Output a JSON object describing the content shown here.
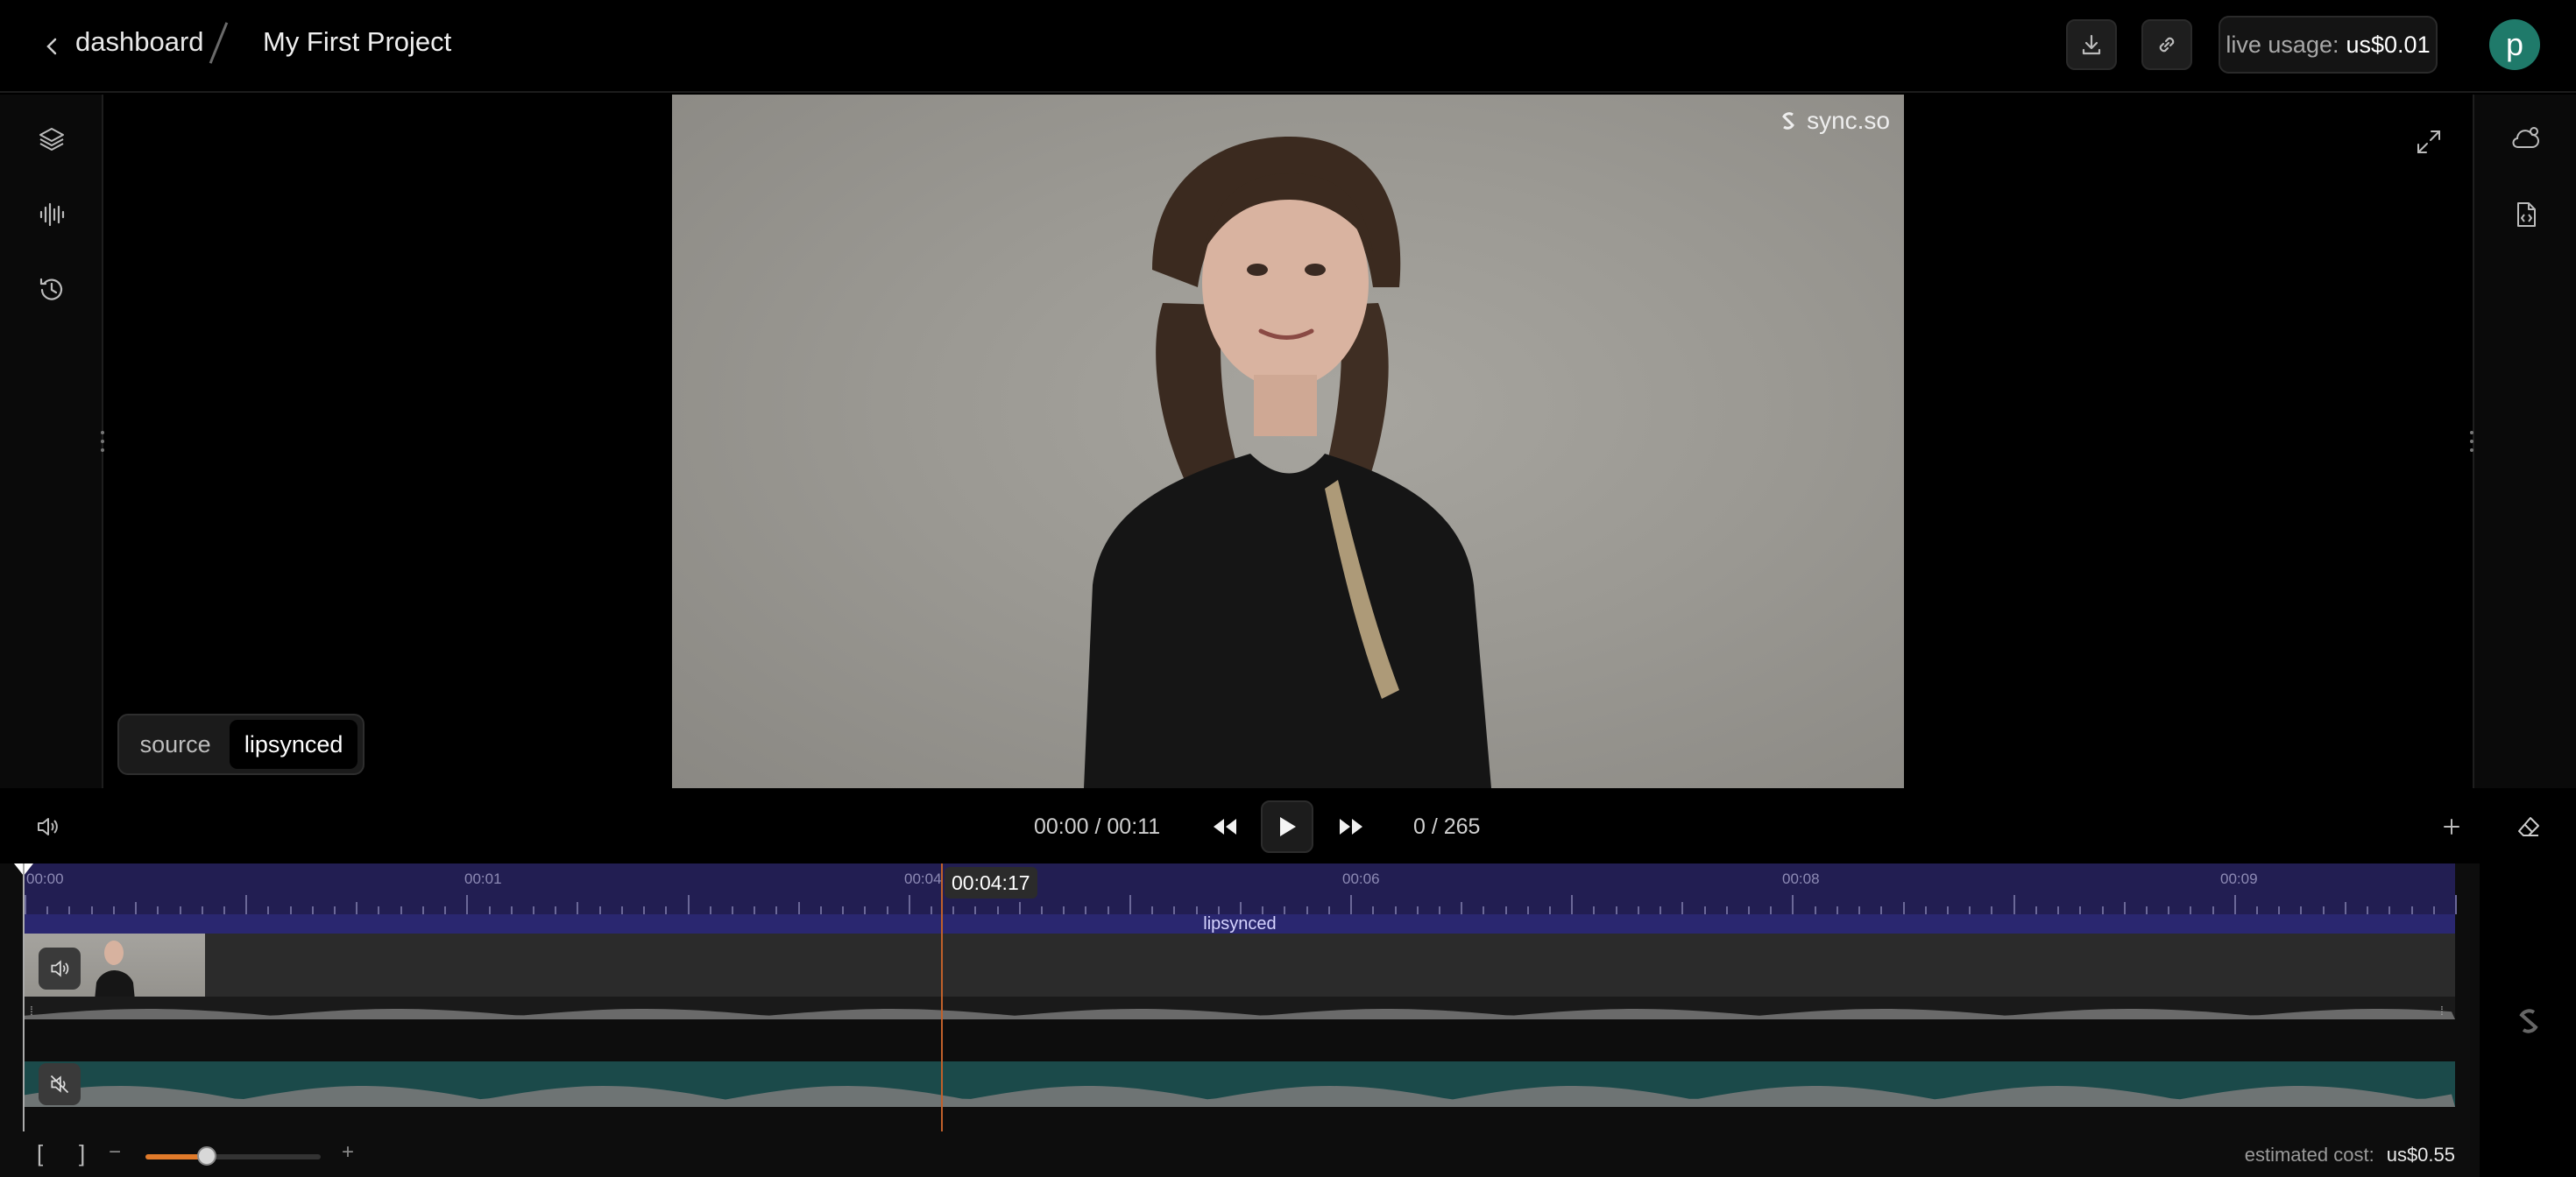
{
  "header": {
    "breadcrumb_back_icon": "chevron-left-icon",
    "breadcrumb_root": "dashboard",
    "project_title": "My First Project",
    "download_icon": "download-icon",
    "share_icon": "link-icon",
    "usage_label": "live usage:",
    "usage_value": "us$0.01",
    "avatar_initial": "p"
  },
  "left_sidebar": {
    "items": [
      "layers-icon",
      "audio-waveform-icon",
      "history-icon"
    ]
  },
  "right_sidebar": {
    "items": [
      "cloud-settings-icon",
      "code-file-icon"
    ]
  },
  "preview": {
    "watermark": "sync.so",
    "expand_icon": "expand-icon",
    "toggle": {
      "options": [
        "source",
        "lipsynced"
      ],
      "selected": "lipsynced"
    }
  },
  "controls": {
    "volume_icon": "volume-icon",
    "timecode": "00:00 / 00:11",
    "rewind_icon": "rewind-icon",
    "play_icon": "play-icon",
    "forward_icon": "fast-forward-icon",
    "frame_counter": "0 / 265",
    "add_icon": "plus-icon",
    "eraser_icon": "eraser-icon"
  },
  "timeline": {
    "tick_labels": [
      "00:00",
      "00:01",
      "00:04",
      "00:06",
      "00:08",
      "00:09"
    ],
    "cursor_time": "00:04:17",
    "clip_label": "lipsynced",
    "track1_icon": "volume-icon",
    "track2_icon": "muted-icon",
    "brand_icon": "sync-logo-icon",
    "playhead_fraction": 0.377,
    "colors": {
      "ruler": "#221e52",
      "clip": "#2a2770",
      "playhead": "#c0602a",
      "audio_track": "#1b4a4a"
    }
  },
  "footer": {
    "bracket_open": "[",
    "bracket_close": "]",
    "zoom_minus": "−",
    "zoom_plus": "+",
    "zoom_level": 0.35,
    "cost_label": "estimated cost:",
    "cost_value": "us$0.55"
  }
}
